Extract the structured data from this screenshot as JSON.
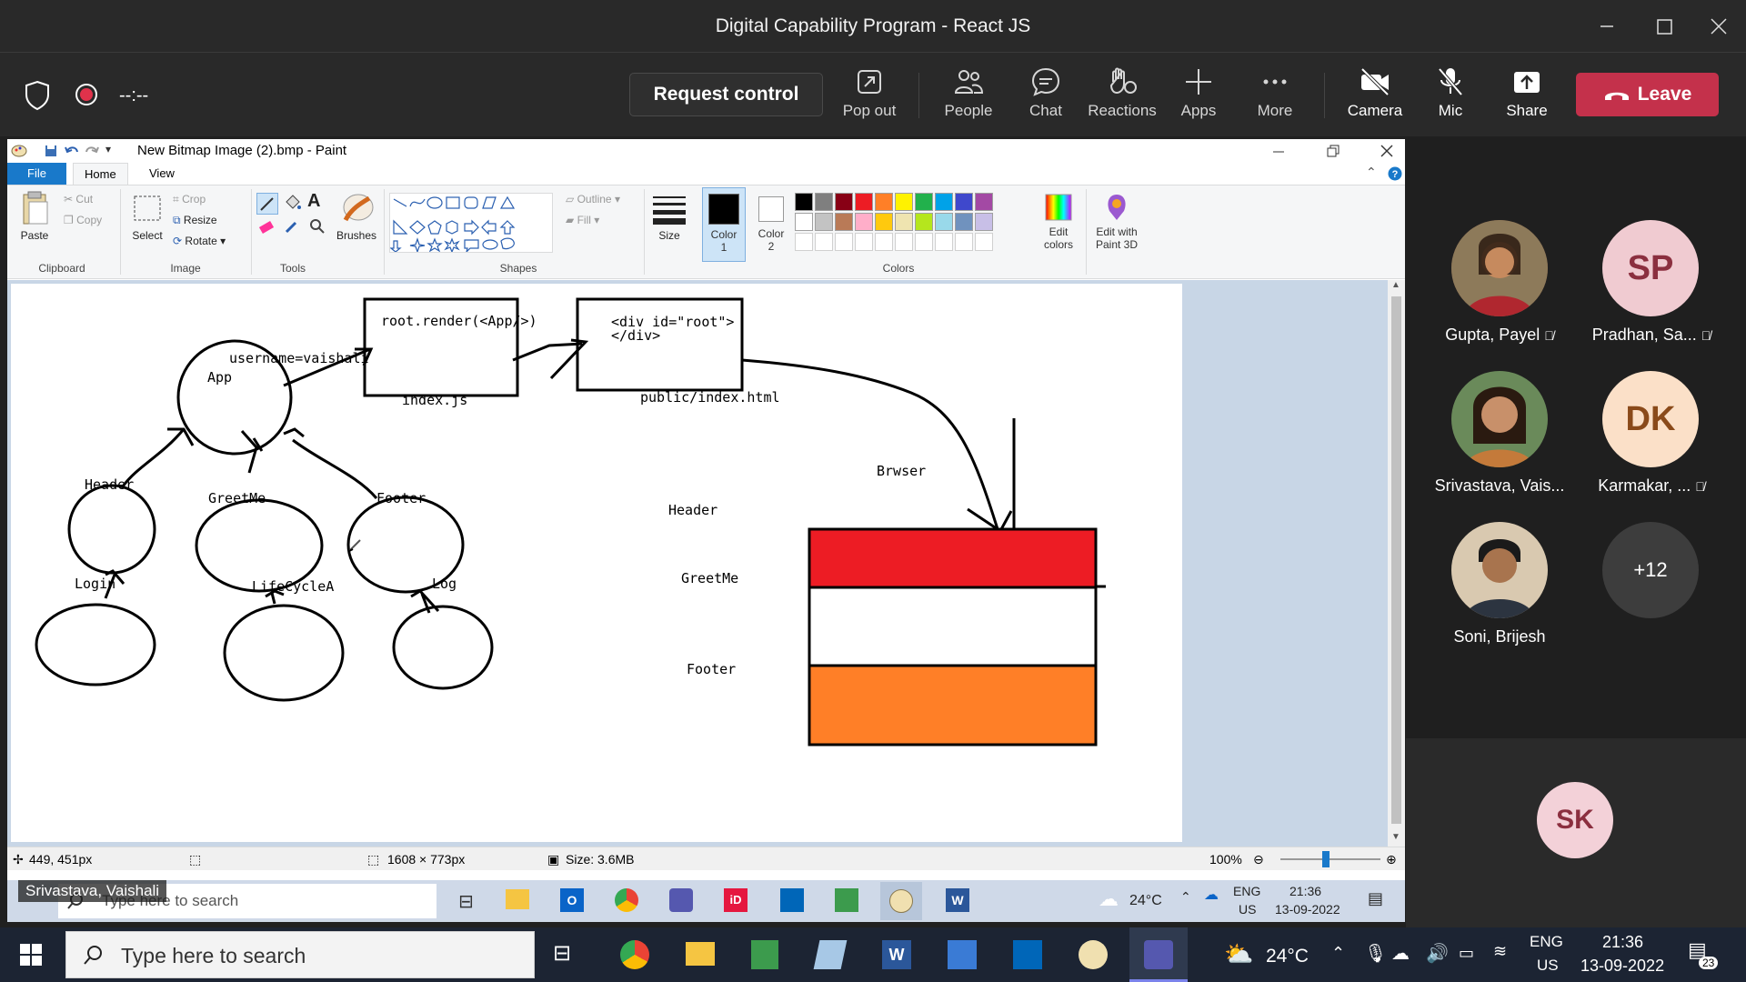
{
  "window": {
    "title": "Digital Capability Program - React JS"
  },
  "meeting": {
    "timer": "--:--",
    "request_control": "Request control",
    "pop_out": "Pop out",
    "people": "People",
    "chat": "Chat",
    "reactions": "Reactions",
    "apps": "Apps",
    "more": "More",
    "camera": "Camera",
    "mic": "Mic",
    "share": "Share",
    "leave": "Leave"
  },
  "paint": {
    "title": "New Bitmap Image (2).bmp - Paint",
    "tabs": {
      "file": "File",
      "home": "Home",
      "view": "View"
    },
    "ribbon": {
      "paste": "Paste",
      "cut": "Cut",
      "copy": "Copy",
      "clipboard": "Clipboard",
      "select": "Select",
      "crop": "Crop",
      "resize": "Resize",
      "rotate": "Rotate",
      "image": "Image",
      "brushes": "Brushes",
      "tools": "Tools",
      "outline": "Outline",
      "fill": "Fill",
      "shapes": "Shapes",
      "size": "Size",
      "color1": "Color",
      "color1_num": "1",
      "color2": "Color",
      "color2_num": "2",
      "edit_colors_1": "Edit",
      "edit_colors_2": "colors",
      "colors": "Colors",
      "paint3d_1": "Edit with",
      "paint3d_2": "Paint 3D"
    },
    "palette": [
      "#000000",
      "#7f7f7f",
      "#880015",
      "#ed1c24",
      "#ff7f27",
      "#fff200",
      "#22b14c",
      "#00a2e8",
      "#3f48cc",
      "#a349a4",
      "#ffffff",
      "#c3c3c3",
      "#b97a57",
      "#ffaec9",
      "#ffc90e",
      "#efe4b0",
      "#b5e61d",
      "#99d9ea",
      "#7092be",
      "#c8bfe7"
    ],
    "drawing": {
      "render_box": "root.render(<App/>)",
      "div_line1": "<div id=\"root\">",
      "div_line2": "</div>",
      "index_js": "index.js",
      "public_index": "public/index.html",
      "username": "username=vaishali",
      "app": "App",
      "header": "Header",
      "greetme": "GreetMe",
      "footer": "Footer",
      "login": "Login",
      "lifecycle": "LifeCycleA",
      "log": "Log",
      "browser": "Brwser",
      "label_header": "Header",
      "label_greetme": "GreetMe",
      "label_footer": "Footer",
      "colors": {
        "top": "#ed1c24",
        "middle": "#ffffff",
        "bottom": "#ff7f27"
      }
    },
    "status": {
      "cursor": "449, 451px",
      "dimensions": "1608 × 773px",
      "size": "Size: 3.6MB",
      "zoom": "100%"
    }
  },
  "inner_taskbar": {
    "search": "Type here to search",
    "weather": "24°C",
    "lang1": "ENG",
    "lang2": "US",
    "time": "21:36",
    "date": "13-09-2022"
  },
  "presenter_badge": "Srivastava, Vaishali",
  "participants": [
    {
      "name": "Gupta, Payel",
      "muted": true
    },
    {
      "name": "Pradhan, Sa...",
      "initials": "SP",
      "muted": true
    },
    {
      "name": "Srivastava, Vais...",
      "muted": false
    },
    {
      "name": "Karmakar, ...",
      "initials": "DK",
      "muted": true
    },
    {
      "name": "Soni, Brijesh",
      "muted": false
    },
    {
      "overflow": "+12"
    }
  ],
  "self_initials": "SK",
  "taskbar": {
    "search": "Type here to search",
    "weather": "24°C",
    "lang1": "ENG",
    "lang2": "US",
    "time": "21:36",
    "date": "13-09-2022",
    "notifications": "23"
  }
}
